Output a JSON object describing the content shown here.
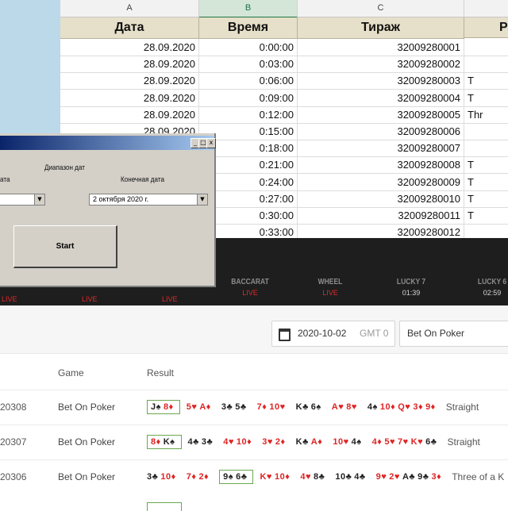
{
  "spreadsheet": {
    "columns": [
      "A",
      "B",
      "C"
    ],
    "headers": [
      "Дата",
      "Время",
      "Тираж",
      "Р"
    ],
    "rows": [
      {
        "date": "28.09.2020",
        "time": "0:00:00",
        "draw": "32009280001",
        "result": ""
      },
      {
        "date": "28.09.2020",
        "time": "0:03:00",
        "draw": "32009280002",
        "result": ""
      },
      {
        "date": "28.09.2020",
        "time": "0:06:00",
        "draw": "32009280003",
        "result": "T"
      },
      {
        "date": "28.09.2020",
        "time": "0:09:00",
        "draw": "32009280004",
        "result": "T"
      },
      {
        "date": "28.09.2020",
        "time": "0:12:00",
        "draw": "32009280005",
        "result": "Thr"
      },
      {
        "date": "28.09.2020",
        "time": "0:15:00",
        "draw": "32009280006",
        "result": ""
      },
      {
        "date": "",
        "time": "0:18:00",
        "draw": "32009280007",
        "result": ""
      },
      {
        "date": "",
        "time": "0:21:00",
        "draw": "32009280008",
        "result": "T"
      },
      {
        "date": "",
        "time": "0:24:00",
        "draw": "32009280009",
        "result": "T"
      },
      {
        "date": "",
        "time": "0:27:00",
        "draw": "32009280010",
        "result": "T"
      },
      {
        "date": "",
        "time": "0:30:00",
        "draw": "32009280011",
        "result": "T"
      },
      {
        "date": "",
        "time": "0:33:00",
        "draw": "32009280012",
        "result": ""
      }
    ]
  },
  "dialog": {
    "range_label": "Диапазон дат",
    "start_label_partial": "ата",
    "end_label": "Конечная дата",
    "end_value": "2  октября  2020 г.",
    "start_button": "Start",
    "btn_min": "_",
    "btn_max": "□",
    "btn_close": "x"
  },
  "nav": {
    "games": [
      {
        "name": "BACCARAT",
        "status": "LIVE",
        "status_type": "live"
      },
      {
        "name": "WHEEL",
        "status": "LIVE",
        "status_type": "live"
      },
      {
        "name": "LUCKY 7",
        "status": "01:39",
        "status_type": "time"
      },
      {
        "name": "LUCKY 6",
        "status": "02:59",
        "status_type": "time"
      }
    ],
    "partial_live_labels": [
      "LIVE",
      "LIVE",
      "LIVE"
    ]
  },
  "filters": {
    "date": "2020-10-02",
    "timezone": "GMT 0",
    "game": "Bet On Poker"
  },
  "results_table": {
    "headers": {
      "game": "Game",
      "result": "Result"
    },
    "rows": [
      {
        "id": "20308",
        "game": "Bet On Poker",
        "groups": [
          {
            "cards": [
              [
                "J♠",
                "black"
              ],
              [
                "8♦",
                "red"
              ]
            ],
            "highlight": true
          },
          {
            "cards": [
              [
                "5♥",
                "red"
              ],
              [
                "A♦",
                "red"
              ]
            ]
          },
          {
            "cards": [
              [
                "3♣",
                "black"
              ],
              [
                "5♣",
                "black"
              ]
            ]
          },
          {
            "cards": [
              [
                "7♦",
                "red"
              ],
              [
                "10♥",
                "red"
              ]
            ]
          },
          {
            "cards": [
              [
                "K♣",
                "black"
              ],
              [
                "6♠",
                "black"
              ]
            ]
          },
          {
            "cards": [
              [
                "A♥",
                "red"
              ],
              [
                "8♥",
                "red"
              ]
            ]
          },
          {
            "cards": [
              [
                "4♠",
                "black"
              ],
              [
                "10♦",
                "red"
              ],
              [
                "Q♥",
                "red"
              ],
              [
                "3♦",
                "red"
              ],
              [
                "9♦",
                "red"
              ]
            ]
          }
        ],
        "combination": "Straight"
      },
      {
        "id": "20307",
        "game": "Bet On Poker",
        "groups": [
          {
            "cards": [
              [
                "8♦",
                "red"
              ],
              [
                "K♠",
                "black"
              ]
            ],
            "highlight": true
          },
          {
            "cards": [
              [
                "4♣",
                "black"
              ],
              [
                "3♣",
                "black"
              ]
            ]
          },
          {
            "cards": [
              [
                "4♥",
                "red"
              ],
              [
                "10♦",
                "red"
              ]
            ]
          },
          {
            "cards": [
              [
                "3♥",
                "red"
              ],
              [
                "2♦",
                "red"
              ]
            ]
          },
          {
            "cards": [
              [
                "K♣",
                "black"
              ],
              [
                "A♦",
                "red"
              ]
            ]
          },
          {
            "cards": [
              [
                "10♥",
                "red"
              ],
              [
                "4♠",
                "black"
              ]
            ]
          },
          {
            "cards": [
              [
                "4♦",
                "red"
              ],
              [
                "5♥",
                "red"
              ],
              [
                "7♥",
                "red"
              ],
              [
                "K♥",
                "red"
              ],
              [
                "6♣",
                "black"
              ]
            ]
          }
        ],
        "combination": "Straight"
      },
      {
        "id": "20306",
        "game": "Bet On Poker",
        "groups": [
          {
            "cards": [
              [
                "3♣",
                "black"
              ],
              [
                "10♦",
                "red"
              ]
            ]
          },
          {
            "cards": [
              [
                "7♦",
                "red"
              ],
              [
                "2♦",
                "red"
              ]
            ]
          },
          {
            "cards": [
              [
                "9♠",
                "black"
              ],
              [
                "6♣",
                "black"
              ]
            ],
            "highlight": true
          },
          {
            "cards": [
              [
                "K♥",
                "red"
              ],
              [
                "10♦",
                "red"
              ]
            ]
          },
          {
            "cards": [
              [
                "4♥",
                "red"
              ],
              [
                "8♣",
                "black"
              ]
            ]
          },
          {
            "cards": [
              [
                "10♣",
                "black"
              ],
              [
                "4♣",
                "black"
              ]
            ]
          },
          {
            "cards": [
              [
                "9♥",
                "red"
              ],
              [
                "2♥",
                "red"
              ],
              [
                "A♣",
                "black"
              ],
              [
                "9♣",
                "black"
              ],
              [
                "3♦",
                "red"
              ]
            ]
          }
        ],
        "combination": "Three of a K"
      }
    ]
  },
  "colors": {
    "live": "#e02a2a",
    "highlight_border": "#6aa84f",
    "sheet_header_fill": "#e6dfc9",
    "nav_background": "#1e1e1e",
    "dialog_title_from": "#0a246a",
    "dialog_title_to": "#a6caf0"
  }
}
